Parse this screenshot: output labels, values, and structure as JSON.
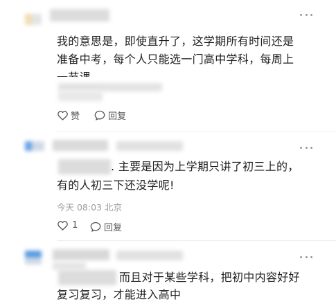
{
  "comments": [
    {
      "text_lines": [
        "我的意思是，即使直升了，这学期所有时间还是",
        "准备中考，每个人只能选一门高中学科，每周上",
        "一节课"
      ],
      "actions": {
        "like_label": "赞",
        "reply_label": "回复"
      }
    },
    {
      "text": ". 主要是因为上学期只讲了初三上的，",
      "text_line2": "有的人初三下还没学呢!",
      "meta": "今天 08:03 北京",
      "actions": {
        "like_count": "1",
        "reply_label": "回复"
      }
    },
    {
      "text": "而且对于某些学科，把初中内容好好",
      "text_line2": "复习复习，才能进入高中"
    }
  ],
  "colors": {
    "avatar_blue": "#4a90e2",
    "avatar_cream": "#e8c98a",
    "meta_gray": "#9c9c9c"
  },
  "icons": [
    "more-icon",
    "heart-icon",
    "comment-icon"
  ]
}
